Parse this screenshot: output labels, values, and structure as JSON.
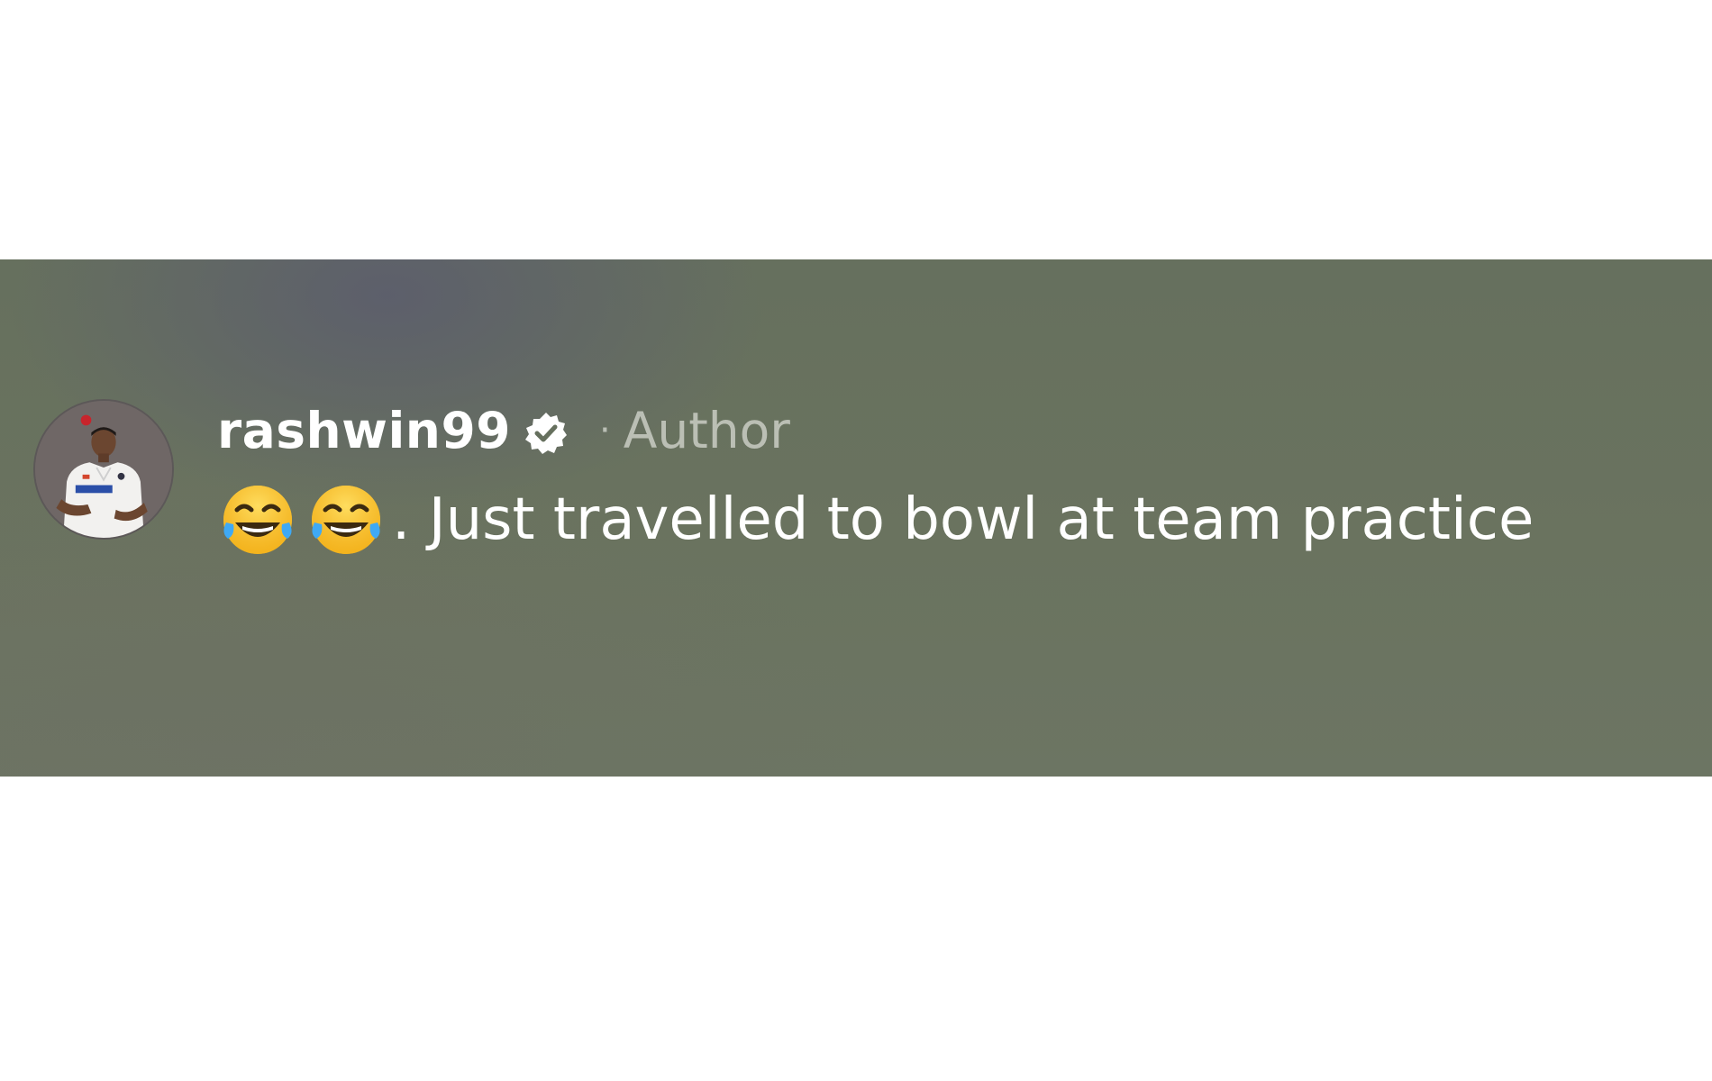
{
  "comment": {
    "username": "rashwin99",
    "separator": "·",
    "role_label": "Author",
    "message_text": ". Just travelled to bowl at team practice",
    "emojis": [
      "tears-of-joy-emoji",
      "tears-of-joy-emoji"
    ]
  },
  "icons": {
    "verified": "verified-badge-icon",
    "avatar": "profile-avatar"
  },
  "colors": {
    "panel_background": "#69725f",
    "username": "#ffffff",
    "role_label": "#c9ccc3",
    "message_text": "#ffffff"
  }
}
